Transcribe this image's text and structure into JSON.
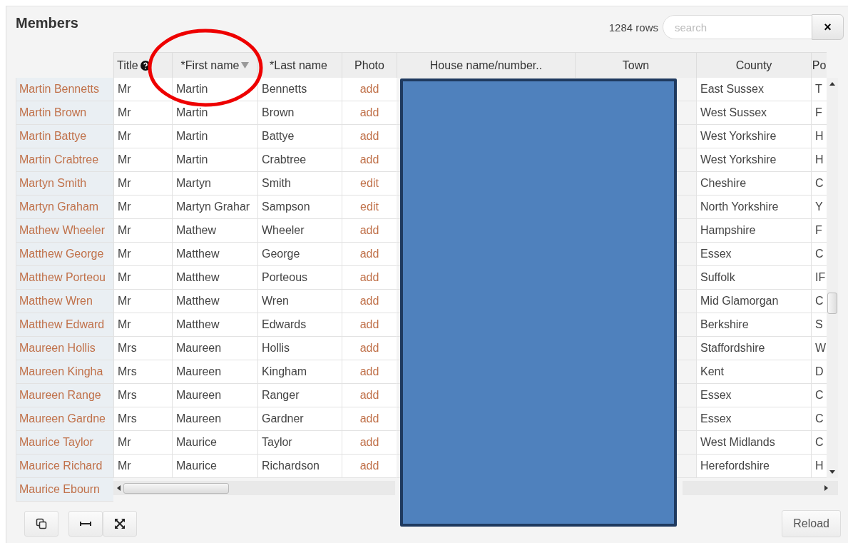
{
  "panel": {
    "title": "Members",
    "row_count": "1284 rows",
    "search": {
      "placeholder": "search"
    },
    "clear_button": "×"
  },
  "table": {
    "columns": [
      {
        "kind": "name"
      },
      {
        "label": "Title",
        "kind": "help"
      },
      {
        "label": "*First name",
        "kind": "sorted"
      },
      {
        "label": "*Last name",
        "kind": "plain"
      },
      {
        "label": "Photo",
        "kind": "plain"
      },
      {
        "label": "House name/number..",
        "kind": "plain"
      },
      {
        "label": "Town",
        "kind": "plain"
      },
      {
        "label": "County",
        "kind": "plain"
      },
      {
        "label": "Po",
        "kind": "plain"
      }
    ],
    "rows": [
      {
        "name": "Martin Bennetts",
        "title": "Mr",
        "first": "Martin",
        "last": "Bennetts",
        "photo": "add",
        "county": "East Sussex",
        "post": "T"
      },
      {
        "name": "Martin Brown",
        "title": "Mr",
        "first": "Martin",
        "last": "Brown",
        "photo": "add",
        "county": "West Sussex",
        "post": "F"
      },
      {
        "name": "Martin Battye",
        "title": "Mr",
        "first": "Martin",
        "last": "Battye",
        "photo": "add",
        "county": "West Yorkshire",
        "post": "H"
      },
      {
        "name": "Martin Crabtree",
        "title": "Mr",
        "first": "Martin",
        "last": "Crabtree",
        "photo": "add",
        "county": "West Yorkshire",
        "post": "H"
      },
      {
        "name": "Martyn Smith",
        "title": "Mr",
        "first": "Martyn",
        "last": "Smith",
        "photo": "edit",
        "county": "Cheshire",
        "post": "C"
      },
      {
        "name": "Martyn Graham",
        "title": "Mr",
        "first": "Martyn Grahar",
        "last": "Sampson",
        "photo": "edit",
        "county": "North Yorkshire",
        "post": "Y"
      },
      {
        "name": "Mathew Wheeler",
        "title": "Mr",
        "first": "Mathew",
        "last": "Wheeler",
        "photo": "add",
        "county": "Hampshire",
        "post": "F"
      },
      {
        "name": "Matthew George",
        "title": "Mr",
        "first": "Matthew",
        "last": "George",
        "photo": "add",
        "county": "Essex",
        "post": "C"
      },
      {
        "name": "Matthew Porteou",
        "title": "Mr",
        "first": "Matthew",
        "last": "Porteous",
        "photo": "add",
        "county": "Suffolk",
        "post": "IF"
      },
      {
        "name": "Matthew Wren",
        "title": "Mr",
        "first": "Matthew",
        "last": "Wren",
        "photo": "add",
        "county": "Mid Glamorgan",
        "post": "C"
      },
      {
        "name": "Matthew Edward",
        "title": "Mr",
        "first": "Matthew",
        "last": "Edwards",
        "photo": "add",
        "county": "Berkshire",
        "post": "S"
      },
      {
        "name": "Maureen Hollis",
        "title": "Mrs",
        "first": "Maureen",
        "last": "Hollis",
        "photo": "add",
        "county": "Staffordshire",
        "post": "W"
      },
      {
        "name": "Maureen Kingha",
        "title": "Mrs",
        "first": "Maureen",
        "last": "Kingham",
        "photo": "add",
        "county": "Kent",
        "post": "D"
      },
      {
        "name": "Maureen Range",
        "title": "Mrs",
        "first": "Maureen",
        "last": "Ranger",
        "photo": "add",
        "county": "Essex",
        "post": "C"
      },
      {
        "name": "Maureen Gardne",
        "title": "Mrs",
        "first": "Maureen",
        "last": "Gardner",
        "photo": "add",
        "county": "Essex",
        "post": "C"
      },
      {
        "name": "Maurice Taylor",
        "title": "Mr",
        "first": "Maurice",
        "last": "Taylor",
        "photo": "add",
        "county": "West Midlands",
        "post": "C"
      },
      {
        "name": "Maurice Richard",
        "title": "Mr",
        "first": "Maurice",
        "last": "Richardson",
        "photo": "add",
        "county": "Herefordshire",
        "post": "H"
      },
      {
        "name": "Maurice Ebourn"
      }
    ]
  },
  "footer": {
    "reload_button": "Reload"
  }
}
